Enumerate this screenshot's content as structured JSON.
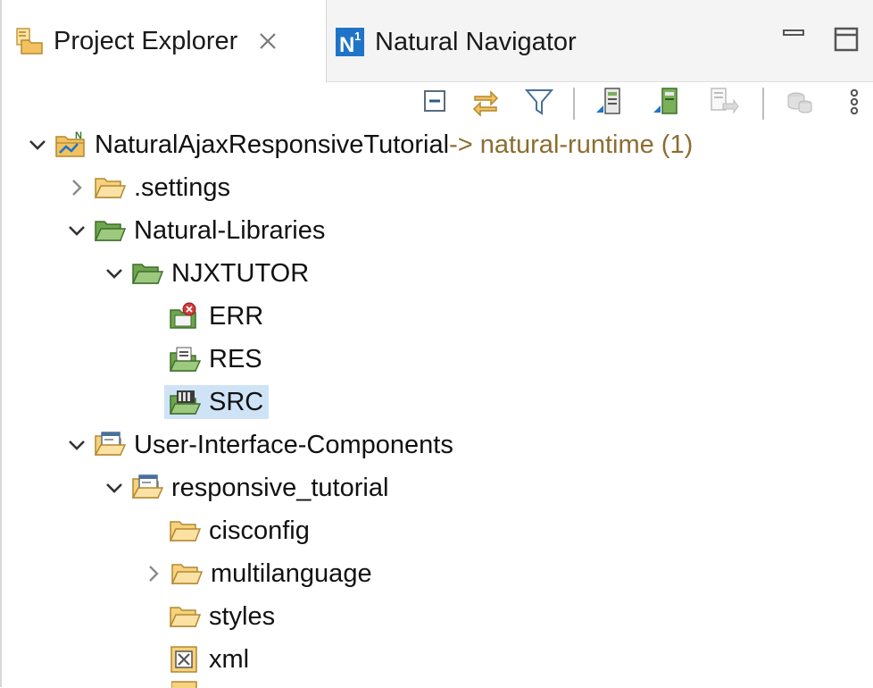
{
  "tabs": [
    {
      "label": "Project Explorer",
      "active": true
    },
    {
      "label": "Natural Navigator",
      "active": false
    }
  ],
  "tree": [
    {
      "label": "NaturalAjaxResponsiveTutorial",
      "decoration": "-> natural-runtime (1)",
      "expanded": true,
      "icon": "natural-project-icon"
    },
    {
      "label": ".settings",
      "expanded": false,
      "icon": "folder-icon"
    },
    {
      "label": "Natural-Libraries",
      "expanded": true,
      "icon": "green-folder-icon"
    },
    {
      "label": "NJXTUTOR",
      "expanded": true,
      "icon": "green-folder-icon"
    },
    {
      "label": "ERR",
      "icon": "error-messages-folder-icon"
    },
    {
      "label": "RES",
      "icon": "resources-folder-icon"
    },
    {
      "label": "SRC",
      "icon": "source-folder-icon",
      "selected": true
    },
    {
      "label": "User-Interface-Components",
      "expanded": true,
      "icon": "ui-components-folder-icon"
    },
    {
      "label": "responsive_tutorial",
      "expanded": true,
      "icon": "ui-components-folder-icon"
    },
    {
      "label": "cisconfig",
      "icon": "folder-icon"
    },
    {
      "label": "multilanguage",
      "expanded": false,
      "icon": "folder-icon"
    },
    {
      "label": "styles",
      "icon": "folder-icon"
    },
    {
      "label": "xml",
      "icon": "xml-folder-icon"
    }
  ],
  "colors": {
    "selection": "#cfe3f6",
    "decoration_text": "#8c6d2f",
    "folder_yellow": "#f1c25f",
    "folder_green": "#7bb05b",
    "natural_blue": "#1f74c8"
  }
}
